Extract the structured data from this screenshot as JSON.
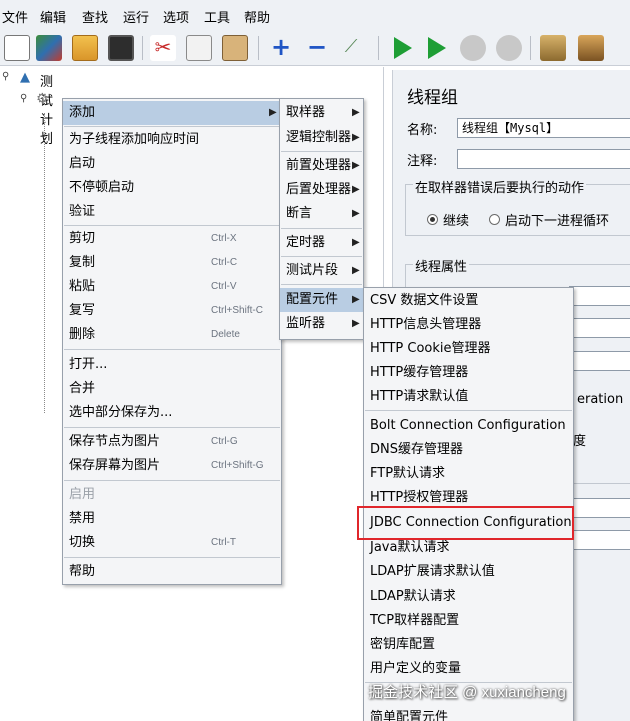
{
  "menubar": [
    "文件",
    "编辑",
    "查找",
    "运行",
    "选项",
    "工具",
    "帮助"
  ],
  "toolbar_icons": [
    "new-icon",
    "templates-icon",
    "open-icon",
    "save-icon",
    "cut-icon",
    "copy-icon",
    "paste-icon",
    "expand-icon",
    "collapse-icon",
    "toggle-icon",
    "start-icon",
    "start-no-pauses-icon",
    "stop-icon",
    "shutdown-icon",
    "clear-icon",
    "clear-all-icon"
  ],
  "tree": {
    "root": "测试计划"
  },
  "panel": {
    "title": "线程组",
    "name_label": "名称:",
    "name_value": "线程组【Mysql】",
    "comment_label": "注释:",
    "error_action_title": "在取样器错误后要执行的动作",
    "opt_continue": "继续",
    "opt_next_loop": "启动下一进程循环",
    "thread_props_title": "线程属性",
    "partial_ration": "eration",
    "partial_du": "度"
  },
  "context_menu": [
    {
      "label": "添加",
      "submenu": true
    },
    {
      "label": "为子线程添加响应时间"
    },
    {
      "label": "启动"
    },
    {
      "label": "不停顿启动"
    },
    {
      "label": "验证"
    },
    {
      "label": "剪切",
      "shortcut": "Ctrl-X"
    },
    {
      "label": "复制",
      "shortcut": "Ctrl-C"
    },
    {
      "label": "粘贴",
      "shortcut": "Ctrl-V"
    },
    {
      "label": "复写",
      "shortcut": "Ctrl+Shift-C"
    },
    {
      "label": "删除",
      "shortcut": "Delete"
    },
    {
      "label": "打开..."
    },
    {
      "label": "合并"
    },
    {
      "label": "选中部分保存为..."
    },
    {
      "label": "保存节点为图片",
      "shortcut": "Ctrl-G"
    },
    {
      "label": "保存屏幕为图片",
      "shortcut": "Ctrl+Shift-G"
    },
    {
      "label": "启用"
    },
    {
      "label": "禁用"
    },
    {
      "label": "切换",
      "shortcut": "Ctrl-T"
    },
    {
      "label": "帮助"
    }
  ],
  "add_submenu": [
    "取样器",
    "逻辑控制器",
    "前置处理器",
    "后置处理器",
    "断言",
    "定时器",
    "测试片段",
    "配置元件",
    "监听器"
  ],
  "config_submenu": [
    "CSV 数据文件设置",
    "HTTP信息头管理器",
    "HTTP Cookie管理器",
    "HTTP缓存管理器",
    "HTTP请求默认值",
    "Bolt Connection Configuration",
    "DNS缓存管理器",
    "FTP默认请求",
    "HTTP授权管理器",
    "JDBC Connection Configuration",
    "Java默认请求",
    "LDAP扩展请求默认值",
    "LDAP默认请求",
    "TCP取样器配置",
    "密钥库配置",
    "用户定义的变量",
    "简单配置元件"
  ],
  "watermark": "掘金技术社区 @ xuxiancheng",
  "colors": {
    "highlight": "#b9cde3",
    "red_box": "#e0262b",
    "panel_bg": "#eef1f5"
  }
}
